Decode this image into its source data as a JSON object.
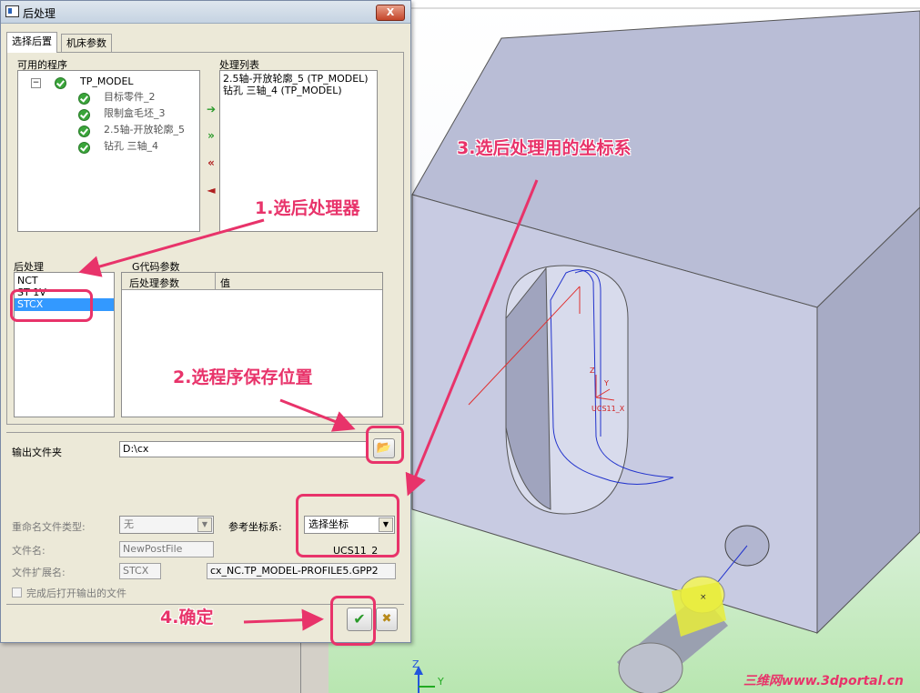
{
  "dialog": {
    "title": "后处理",
    "close_label": "X",
    "tabs": [
      {
        "label": "选择后置"
      },
      {
        "label": "机床参数"
      }
    ],
    "available_label": "可用的程序",
    "process_list_label": "处理列表",
    "tree": {
      "root": "TP_MODEL",
      "children": [
        "目标零件_2",
        "限制盒毛坯_3",
        "2.5轴-开放轮廓_5",
        "钻孔 三轴_4"
      ]
    },
    "process_items": [
      "2.5轴-开放轮廓_5 (TP_MODEL)",
      "钻孔 三轴_4 (TP_MODEL)"
    ],
    "postproc_label": "后处理",
    "postprocessors": [
      "NCT",
      "ST 1V",
      "STCX"
    ],
    "gcode_label": "G代码参数",
    "gcode_columns": [
      "后处理参数",
      "值"
    ],
    "output_folder_label": "输出文件夹",
    "output_folder_value": "D:\\cx",
    "rename_type_label": "重命名文件类型:",
    "rename_type_value": "无",
    "ref_cs_label": "参考坐标系:",
    "ref_cs_value": "选择坐标",
    "ref_cs_name": "UCS11_2",
    "filename_label": "文件名:",
    "filename_value": "NewPostFile",
    "ext_label": "文件扩展名:",
    "ext_value": "STCX",
    "output_path": "cx_NC.TP_MODEL-PROFILE5.GPP2",
    "open_after_label": "完成后打开输出的文件"
  },
  "annotations": {
    "step1": "1.选后处理器",
    "step2": "2.选程序保存位置",
    "step3": "3.选后处理用的坐标系",
    "step4": "4.确定"
  },
  "viewport": {
    "ucs_label": "UCS11_X",
    "axis_z": "Z",
    "axis_y": "Y",
    "triad_z": "Z",
    "triad_y": "Y"
  },
  "watermark": "三维网www.3dportal.cn",
  "colors": {
    "accent": "#e8336a",
    "selection": "#3399ff"
  }
}
